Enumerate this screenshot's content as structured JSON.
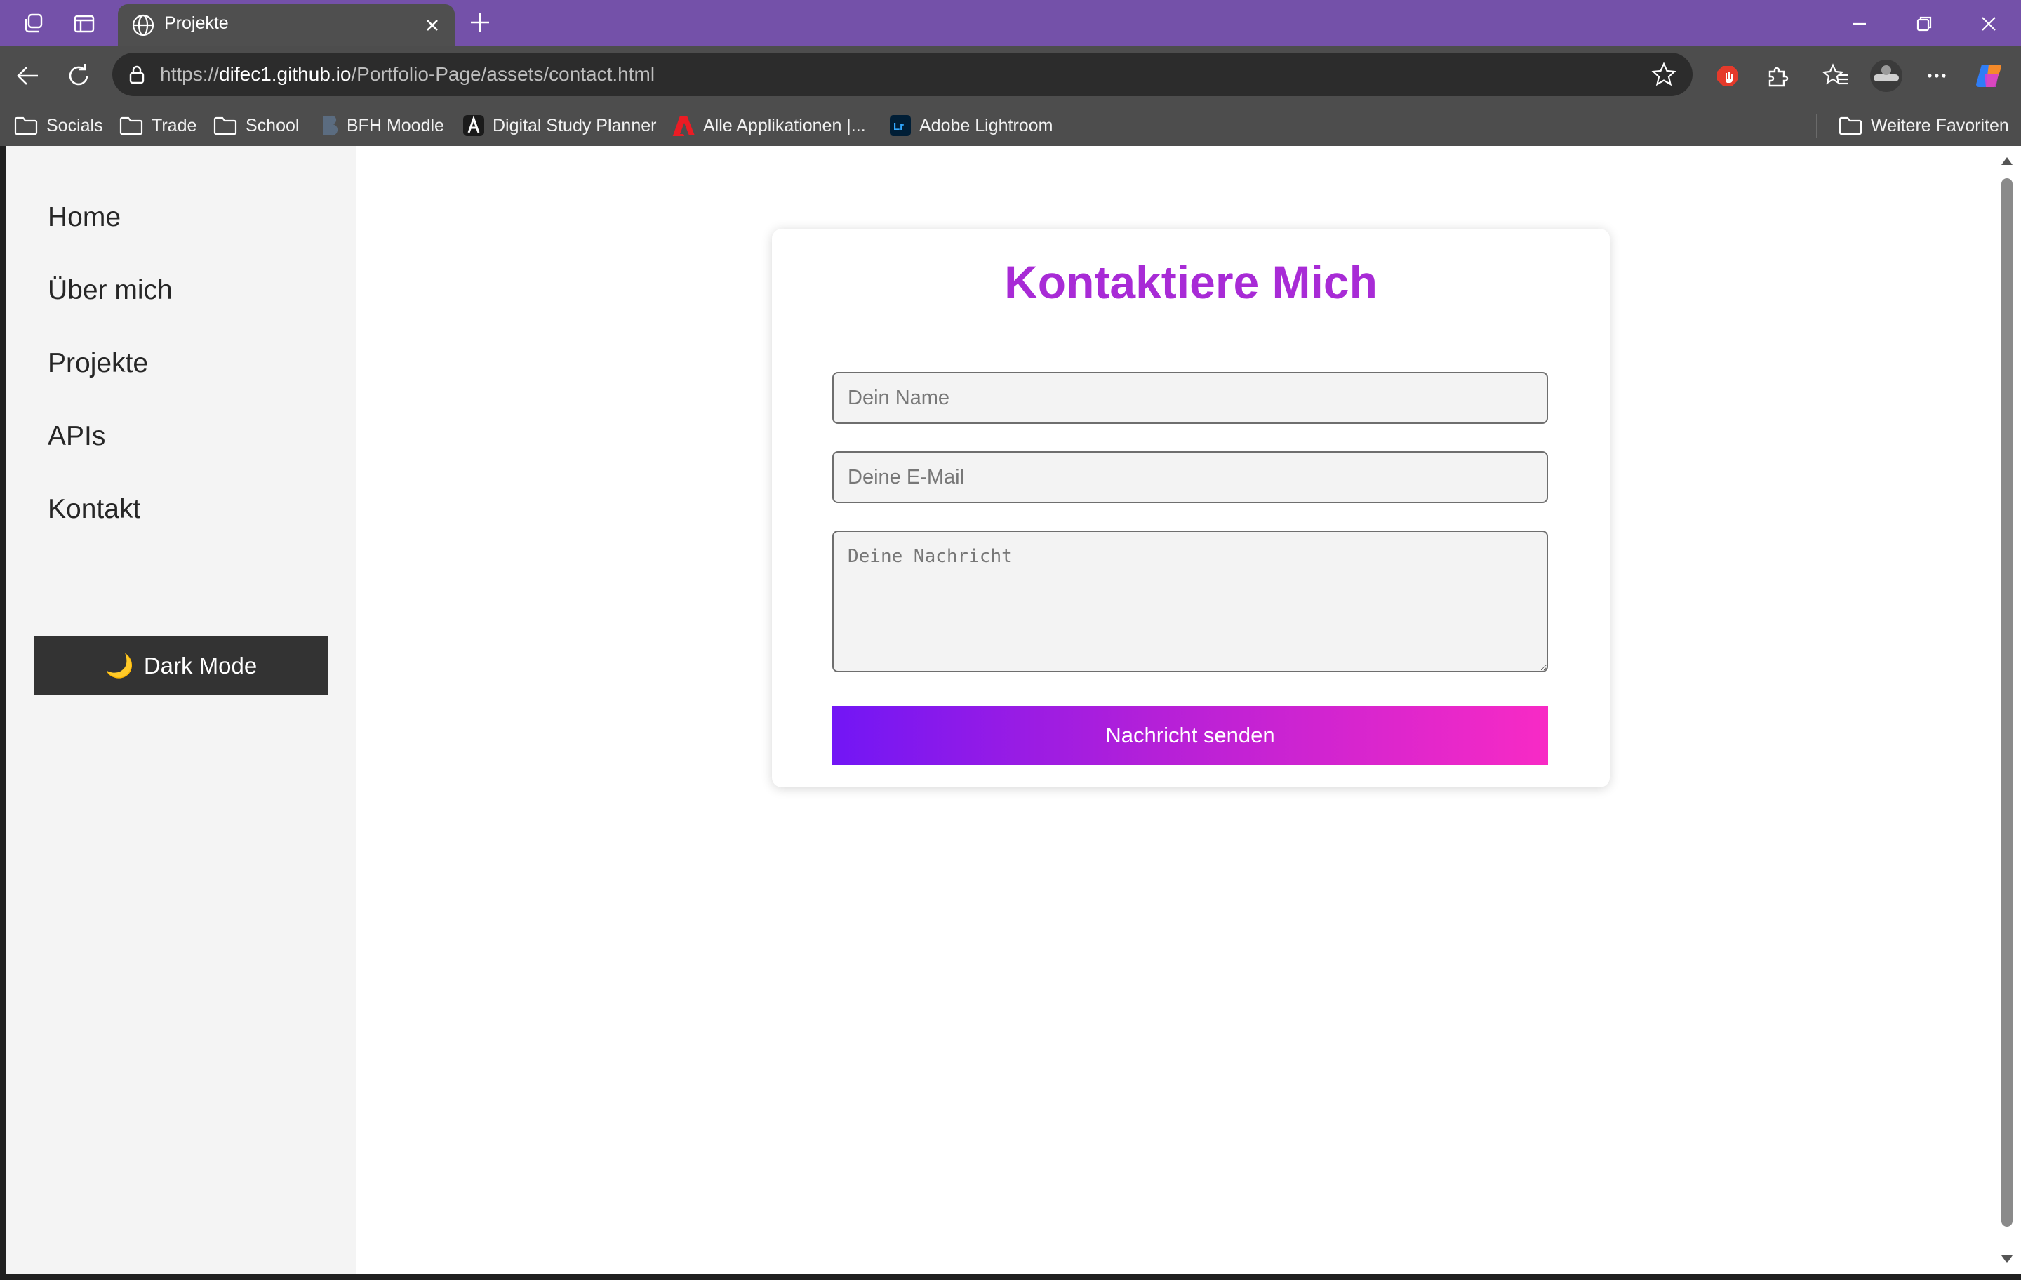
{
  "browser": {
    "tab_title": "Projekte",
    "url_scheme": "https://",
    "url_host": "difec1.github.io",
    "url_path": "/Portfolio-Page/assets/contact.html",
    "accent_color": "#7451a9",
    "bookmarks": [
      {
        "label": "Socials",
        "icon": "folder-icon"
      },
      {
        "label": "Trade",
        "icon": "folder-icon"
      },
      {
        "label": "School",
        "icon": "folder-icon"
      },
      {
        "label": "BFH Moodle",
        "icon": "moodle-icon"
      },
      {
        "label": "Digital Study Planner",
        "icon": "study-planner-icon"
      },
      {
        "label": "Alle Applikationen |...",
        "icon": "adobe-icon"
      },
      {
        "label": "Adobe Lightroom",
        "icon": "lightroom-icon"
      }
    ],
    "other_favorites": "Weitere Favoriten"
  },
  "sidebar": {
    "items": [
      {
        "label": "Home"
      },
      {
        "label": "Über mich"
      },
      {
        "label": "Projekte"
      },
      {
        "label": "APIs"
      },
      {
        "label": "Kontakt"
      }
    ],
    "dark_mode_icon": "🌙",
    "dark_mode_label": "Dark Mode"
  },
  "contact": {
    "title": "Kontaktiere Mich",
    "title_color": "#a82bd6",
    "name_placeholder": "Dein Name",
    "email_placeholder": "Deine E-Mail",
    "message_placeholder": "Deine Nachricht",
    "send_label": "Nachricht senden",
    "send_gradient": [
      "#7216f5",
      "#f82ac5"
    ]
  }
}
